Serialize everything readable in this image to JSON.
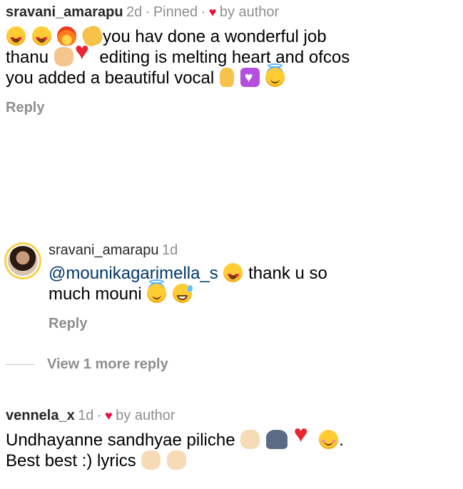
{
  "comments": [
    {
      "username": "sravani_amarapu",
      "time": "2d",
      "pinned": "Pinned",
      "liked_by": "by author",
      "line1": "you hav done a wonderful job",
      "line2a": "thanu",
      "line2b": "editing is melting heart and ofcos",
      "line3": "you added a beautiful vocal",
      "reply": "Reply"
    },
    {
      "username": "sravani_amarapu",
      "time": "1d",
      "mention": "@mounikagarimella_s",
      "line1": "thank u so",
      "line2": "much mouni",
      "reply": "Reply"
    },
    {
      "username": "vennela_x",
      "time": "1d",
      "liked_by": "by author",
      "line1": "Undhayanne sandhyae piliche",
      "line1_end": ".",
      "line2": "Best best :) lyrics"
    }
  ],
  "view_more": "View 1 more reply",
  "separator": "·",
  "colors": {
    "heart": "#ed0f3b",
    "mention": "#00376b",
    "muted": "#8e8e8e",
    "avatar_ring": "#f5d24a"
  },
  "icons": [
    "heart-eyes-emoji",
    "fire-emoji",
    "clap-emoji",
    "pinching-hand-emoji",
    "red-heart-emoji",
    "crossed-fingers-emoji",
    "purple-heart-emoji",
    "halo-emoji",
    "grinning-sweat-emoji",
    "people-emoji",
    "blush-emoji",
    "ok-hand-emoji"
  ]
}
